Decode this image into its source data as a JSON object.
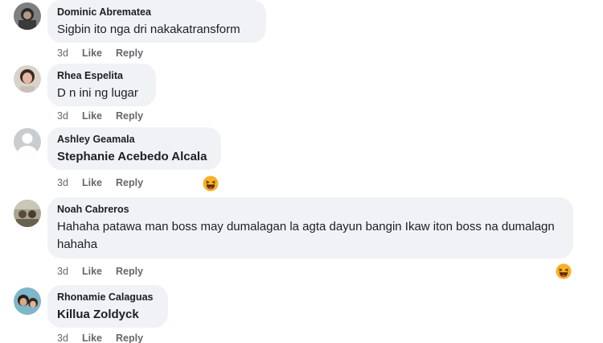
{
  "comments": [
    {
      "author": "Dominic Abrematea",
      "text": "Sigbin ito nga dri nakakatransform",
      "time": "3d",
      "like_label": "Like",
      "reply_label": "Reply",
      "avatar": "profile-photo",
      "reaction": null
    },
    {
      "author": "Rhea Espelita",
      "text": "D n ini ng lugar",
      "time": "3d",
      "like_label": "Like",
      "reply_label": "Reply",
      "avatar": "profile-photo",
      "reaction": null
    },
    {
      "author": "Ashley Geamala",
      "text": "Stephanie Acebedo Alcala",
      "text_is_mention": true,
      "time": "3d",
      "like_label": "Like",
      "reply_label": "Reply",
      "avatar": "default-avatar",
      "reaction": "haha"
    },
    {
      "author": "Noah Cabreros",
      "text": "Hahaha patawa man boss may dumalagan la agta dayun bangin Ikaw iton boss na dumalagn hahaha",
      "time": "3d",
      "like_label": "Like",
      "reply_label": "Reply",
      "avatar": "profile-photo",
      "reaction": "haha"
    },
    {
      "author": "Rhonamie Calaguas",
      "text": "Killua Zoldyck",
      "text_is_mention": true,
      "time": "3d",
      "like_label": "Like",
      "reply_label": "Reply",
      "avatar": "profile-photo",
      "reaction": null
    }
  ],
  "colors": {
    "bubble": "#f0f2f5",
    "text": "#1c1e21",
    "secondary": "#65676b",
    "haha": "#f7b125"
  }
}
